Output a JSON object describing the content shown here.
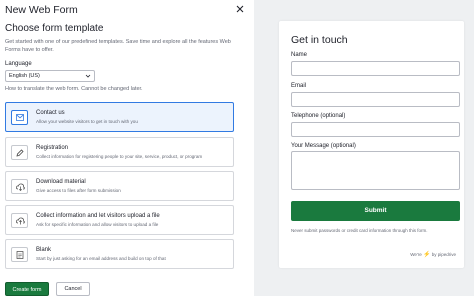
{
  "dialog": {
    "title": "New Web Form",
    "heading": "Choose form template",
    "description": "Get started with one of our predefined templates. Save time and explore all the features Web Forms have to offer."
  },
  "language": {
    "label": "Language",
    "selected": "English (US)",
    "help": "How to translate the web form. Cannot be changed later."
  },
  "templates": [
    {
      "name": "Contact us",
      "description": "Allow your website visitors to get in touch with you",
      "icon": "mail-icon",
      "selected": true
    },
    {
      "name": "Registration",
      "description": "Collect information for registering people to your site, service, product, or program",
      "icon": "pencil-icon",
      "selected": false
    },
    {
      "name": "Download material",
      "description": "Give access to files after form submission",
      "icon": "cloud-download-icon",
      "selected": false
    },
    {
      "name": "Collect information and let visitors upload a file",
      "description": "Ask for specific information and allow visitors to upload a file",
      "icon": "cloud-upload-icon",
      "selected": false
    },
    {
      "name": "Blank",
      "description": "Start by just asking for an email address and build on top of that",
      "icon": "document-icon",
      "selected": false
    }
  ],
  "buttons": {
    "create": "Create form",
    "cancel": "Cancel"
  },
  "preview": {
    "title": "Get in touch",
    "fields": {
      "name": "Name",
      "email": "Email",
      "phone": "Telephone (optional)",
      "message": "Your Message (optional)"
    },
    "submit": "Submit",
    "note": "Never submit passwords or credit card information through this form.",
    "brand_prefix": "We're",
    "brand_suffix": "by pipedrive"
  },
  "colors": {
    "accent_green": "#1a7a3e",
    "selected_blue": "#317ae2",
    "preview_bg": "#eef0f2"
  }
}
